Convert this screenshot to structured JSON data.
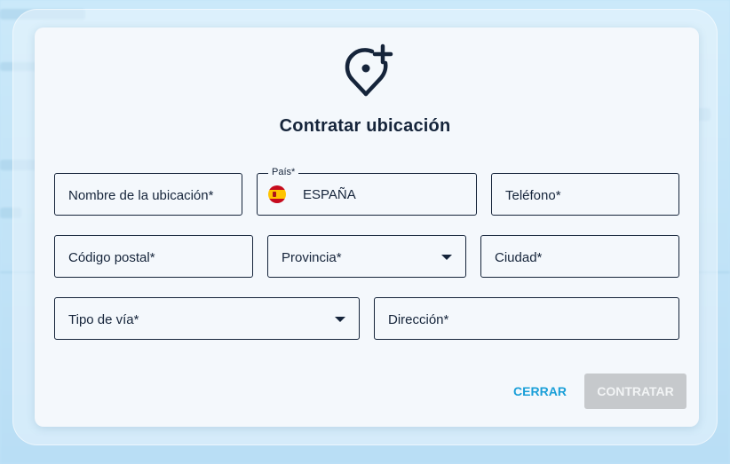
{
  "modal": {
    "title": "Contratar ubicación",
    "icon": "location-pin-plus-icon"
  },
  "fields": {
    "location_name": {
      "placeholder": "Nombre de la ubicación*"
    },
    "country": {
      "label": "País*",
      "value": "ESPAÑA",
      "flag": "spain-flag-icon"
    },
    "phone": {
      "placeholder": "Teléfono*"
    },
    "postal_code": {
      "placeholder": "Código postal*"
    },
    "province": {
      "placeholder": "Provincia*"
    },
    "city": {
      "placeholder": "Ciudad*"
    },
    "street_type": {
      "placeholder": "Tipo de vía*"
    },
    "address": {
      "placeholder": "Dirección*"
    }
  },
  "actions": {
    "close_label": "CERRAR",
    "submit_label": "CONTRATAR"
  },
  "colors": {
    "text_primary": "#15243a",
    "accent": "#1a9fd8",
    "disabled_button": "#c6c9cc",
    "modal_bg": "#f4f8fc"
  }
}
